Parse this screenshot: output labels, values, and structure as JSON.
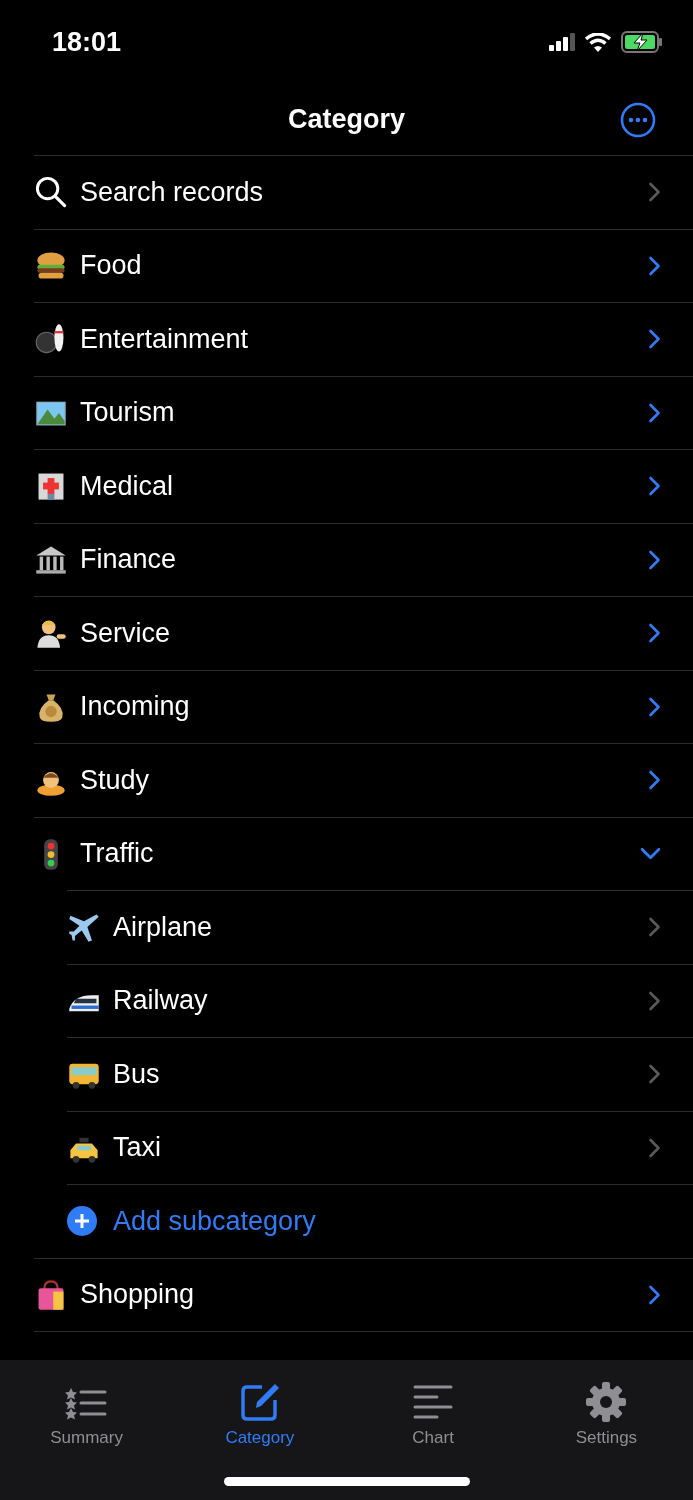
{
  "status_bar": {
    "time": "18:01"
  },
  "nav": {
    "title": "Category"
  },
  "search": {
    "label": "Search records"
  },
  "categories": [
    {
      "name": "Food",
      "expanded": false
    },
    {
      "name": "Entertainment",
      "expanded": false
    },
    {
      "name": "Tourism",
      "expanded": false
    },
    {
      "name": "Medical",
      "expanded": false
    },
    {
      "name": "Finance",
      "expanded": false
    },
    {
      "name": "Service",
      "expanded": false
    },
    {
      "name": "Incoming",
      "expanded": false
    },
    {
      "name": "Study",
      "expanded": false
    },
    {
      "name": "Traffic",
      "expanded": true,
      "children": [
        {
          "name": "Airplane"
        },
        {
          "name": "Railway"
        },
        {
          "name": "Bus"
        },
        {
          "name": "Taxi"
        }
      ],
      "add_label": "Add subcategory"
    },
    {
      "name": "Shopping",
      "expanded": false
    }
  ],
  "tabs": [
    {
      "label": "Summary",
      "selected": false
    },
    {
      "label": "Category",
      "selected": true
    },
    {
      "label": "Chart",
      "selected": false
    },
    {
      "label": "Settings",
      "selected": false
    }
  ]
}
